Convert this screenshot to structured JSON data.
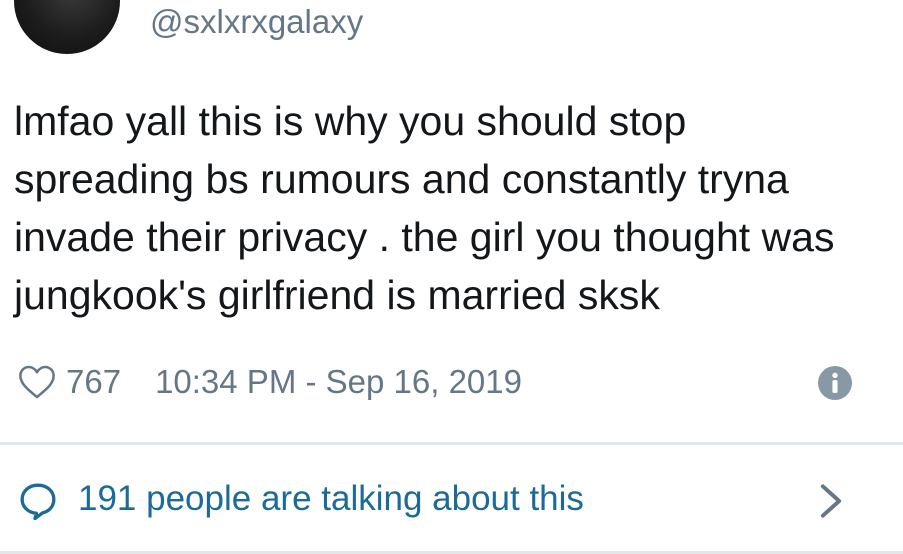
{
  "tweet": {
    "handle": "@sxlxrxgalaxy",
    "text": "lmfao yall this is why you should stop\nspreading bs rumours and constantly tryna\ninvade their privacy . the girl you thought was\njungkook's girlfriend is married sksk",
    "likes": "767",
    "timestamp": "10:34 PM - Sep 16, 2019"
  },
  "conversation": {
    "label": "191 people are talking about this"
  },
  "icons": {
    "like": "heart-icon",
    "info": "info-icon",
    "conversation": "speech-bubble-icon",
    "navigate": "chevron-right-icon"
  },
  "colors": {
    "text": "#14171a",
    "muted": "#657786",
    "link": "#1b6a9a",
    "divider": "#e1e8ed"
  }
}
